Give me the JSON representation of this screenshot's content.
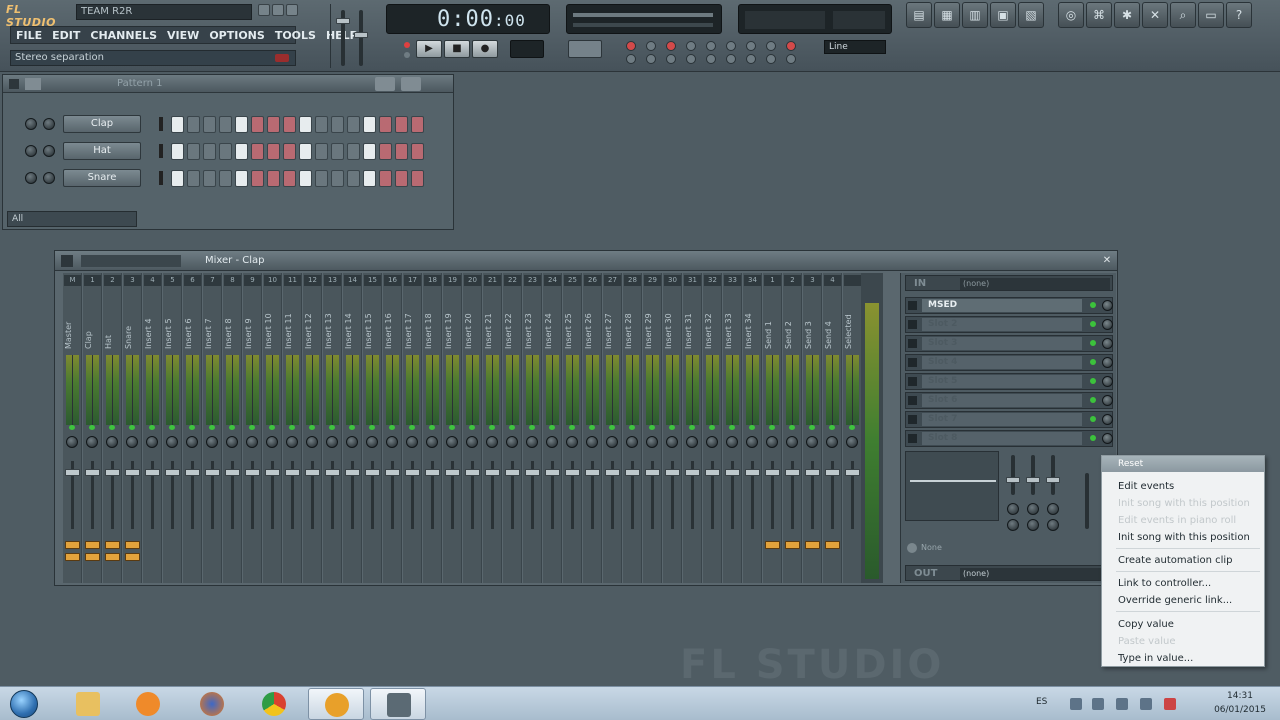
{
  "app": {
    "logo": "FL STUDIO",
    "title_field": "TEAM R2R",
    "menu": [
      "FILE",
      "EDIT",
      "CHANNELS",
      "VIEW",
      "OPTIONS",
      "TOOLS",
      "HELP"
    ],
    "hint": "Stereo separation",
    "time": "0:00",
    "time_ms": ":00",
    "snap": "Line",
    "watermark": "FL STUDIO"
  },
  "sequencer": {
    "title": "Pattern 1",
    "channels": [
      "Clap",
      "Hat",
      "Snare"
    ],
    "filter": "All"
  },
  "mixer": {
    "title": "Mixer - Clap",
    "tracks": [
      "Master",
      "Clap",
      "Hat",
      "Snare",
      "Insert 4",
      "Insert 5",
      "Insert 6",
      "Insert 7",
      "Insert 8",
      "Insert 9",
      "Insert 10",
      "Insert 11",
      "Insert 12",
      "Insert 13",
      "Insert 14",
      "Insert 15",
      "Insert 16",
      "Insert 17",
      "Insert 18",
      "Insert 19",
      "Insert 20",
      "Insert 21",
      "Insert 22",
      "Insert 23",
      "Insert 24",
      "Insert 25",
      "Insert 26",
      "Insert 27",
      "Insert 28",
      "Insert 29",
      "Insert 30",
      "Insert 31",
      "Insert 32",
      "Insert 33",
      "Insert 34",
      "Send 1",
      "Send 2",
      "Send 3",
      "Send 4",
      "Selected"
    ],
    "track_numbers": [
      "M",
      "1",
      "2",
      "3",
      "4",
      "5",
      "6",
      "7",
      "8",
      "9",
      "10",
      "11",
      "12",
      "13",
      "14",
      "15",
      "16",
      "17",
      "18",
      "19",
      "20",
      "21",
      "22",
      "23",
      "24",
      "25",
      "26",
      "27",
      "28",
      "29",
      "30",
      "31",
      "32",
      "33",
      "34",
      "1",
      "2",
      "3",
      "4",
      ""
    ],
    "fx": {
      "in_label": "IN",
      "in_value": "(none)",
      "slots": [
        "MSED",
        "Slot 2",
        "Slot 3",
        "Slot 4",
        "Slot 5",
        "Slot 6",
        "Slot 7",
        "Slot 8"
      ],
      "none_label": "None",
      "out_label": "OUT",
      "out_value": "(none)"
    }
  },
  "context_menu": {
    "title": "Reset",
    "items": [
      {
        "label": "Edit events",
        "enabled": true
      },
      {
        "label": "Init song with this position",
        "enabled": false
      },
      {
        "label": "Edit events in piano roll",
        "enabled": false
      },
      {
        "label": "Init song with this position",
        "enabled": true
      },
      {
        "label": "Create automation clip",
        "enabled": true
      },
      {
        "label": "Link to controller...",
        "enabled": true
      },
      {
        "label": "Override generic link...",
        "enabled": true
      },
      {
        "label": "Copy value",
        "enabled": true
      },
      {
        "label": "Paste value",
        "enabled": false
      },
      {
        "label": "Type in value...",
        "enabled": true
      }
    ]
  },
  "taskbar": {
    "language": "ES",
    "time": "14:31",
    "date": "06/01/2015"
  },
  "colors": {
    "accent_orange": "#e2a23c",
    "step_pink": "#b96a72",
    "meter_green": "#4a7a30"
  }
}
